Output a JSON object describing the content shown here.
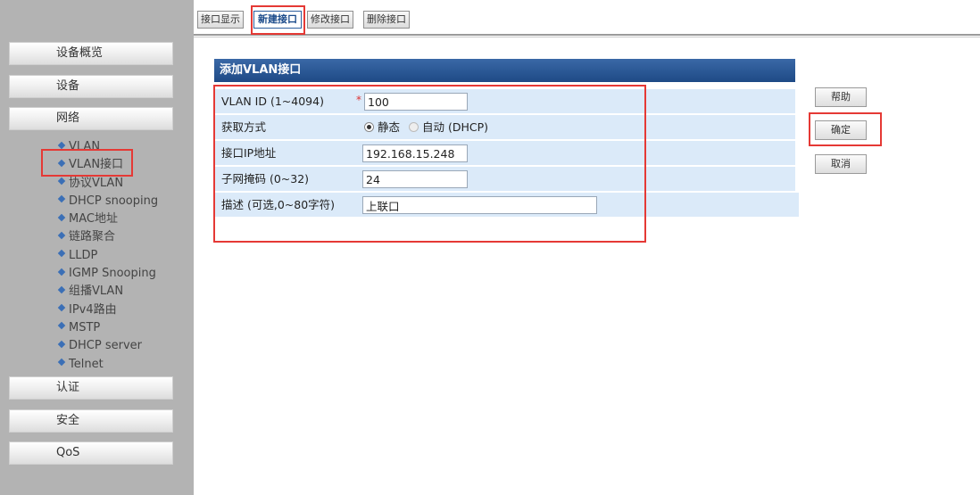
{
  "tabs": [
    {
      "label": "接口显示",
      "active": false
    },
    {
      "label": "新建接口",
      "active": true
    },
    {
      "label": "修改接口",
      "active": false
    },
    {
      "label": "删除接口",
      "active": false
    }
  ],
  "sidebar": {
    "sections": {
      "overview": "设备概览",
      "device": "设备",
      "network": "网络",
      "auth": "认证",
      "security": "安全",
      "qos": "QoS"
    },
    "network_items": [
      "VLAN",
      "VLAN接口",
      "协议VLAN",
      "DHCP snooping",
      "MAC地址",
      "链路聚合",
      "LLDP",
      "IGMP Snooping",
      "组播VLAN",
      "IPv4路由",
      "MSTP",
      "DHCP server",
      "Telnet"
    ]
  },
  "form": {
    "title": "添加VLAN接口",
    "vlan_id": {
      "label": "VLAN ID (1~4094)",
      "required_mark": "*",
      "value": "100"
    },
    "acquire": {
      "label": "获取方式",
      "option_static": "静态",
      "option_auto": "自动 (DHCP)",
      "selected": "static"
    },
    "ip": {
      "label": "接口IP地址",
      "value": "192.168.15.248"
    },
    "mask": {
      "label": "子网掩码 (0~32)",
      "value": "24"
    },
    "desc": {
      "label": "描述 (可选,0~80字符)",
      "value": "上联口"
    }
  },
  "buttons": {
    "help": "帮助",
    "confirm": "确定",
    "cancel": "取消"
  },
  "colors": {
    "sidebar_bg": "#b3b3b3",
    "panel_header": "#2a5894",
    "row_bg": "#dbeaf9",
    "highlight": "#e53935"
  }
}
